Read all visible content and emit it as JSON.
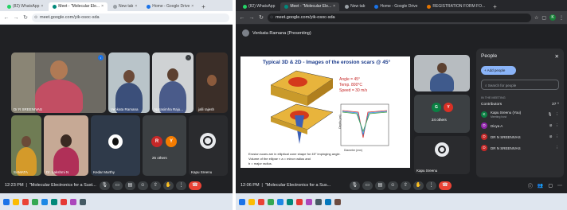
{
  "left": {
    "tabs": [
      {
        "label": "(82) WhatsApp",
        "active": false,
        "color": "#25d366"
      },
      {
        "label": "Meet - \"Molecular Ele...",
        "active": true,
        "color": "#00897b"
      },
      {
        "label": "New tab",
        "active": false,
        "color": "#9aa0a6"
      },
      {
        "label": "Home - Google Drive",
        "active": false,
        "color": "#1a73e8"
      }
    ],
    "url": "meet.google.com/yik-osoc-sda",
    "tiles": [
      {
        "name": "Dr R SREENIVAS"
      },
      {
        "name": "Venkata Ramana"
      },
      {
        "name": "Narasimha Raju..."
      },
      {
        "name": "jalli rajesh"
      },
      {
        "name": "SAMATA"
      },
      {
        "name": "Dr. Lakshmi N"
      },
      {
        "name": "Kedar Murthy"
      },
      {
        "name": "25 others",
        "avatars": [
          "R",
          "Y"
        ]
      },
      {
        "name": "Kapu Sreenu"
      }
    ],
    "bottom": {
      "time": "12:23 PM",
      "title": "\"Molecular Electronics for a Sust..."
    }
  },
  "right": {
    "tabs": [
      {
        "label": "(82) WhatsApp",
        "active": false,
        "color": "#25d366"
      },
      {
        "label": "Meet - \"Molecular Ele...",
        "active": true,
        "color": "#00897b"
      },
      {
        "label": "New tab",
        "active": false,
        "color": "#9aa0a6"
      },
      {
        "label": "Home - Google Drive",
        "active": false,
        "color": "#1a73e8"
      },
      {
        "label": "REGISTRATION FORM FO...",
        "active": false,
        "color": "#e37400"
      }
    ],
    "url": "meet.google.com/yik-osoc-sda",
    "presenter": "Venkata Ramana (Presenting)",
    "slide": {
      "title": "Typical 3D & 2D - Images of the erosion scars @ 45°",
      "params": [
        "Angle = 45°",
        "Temp. 800°C",
        "Speed = 30 m/s"
      ],
      "bullets": [
        "Erosion scars are in elliptical cone shape for 45° impinging angle.",
        "Volume of the ellipse ≈ a = minor radius and",
        "b = major radius."
      ],
      "xlabel": "Diameter (mm)",
      "ylabel": "Depth (μm)"
    },
    "side_tiles": [
      {
        "name": ""
      },
      {
        "name": "24 others",
        "avatars": [
          "G",
          "Y"
        ]
      },
      {
        "name": "Kapu Sreenu"
      }
    ],
    "panel": {
      "title": "People",
      "add_label": "Add people",
      "search_placeholder": "Search for people",
      "section": "IN THE MEETING",
      "group": "Contributors",
      "count": "37",
      "people": [
        {
          "name": "Kapu Sreenu (You)",
          "sub": "Meeting host",
          "initial": "K",
          "color": "#0b8043"
        },
        {
          "name": "Divya A",
          "sub": "",
          "initial": "D",
          "color": "#8e24aa"
        },
        {
          "name": "DR N SREENIVAS",
          "sub": "",
          "initial": "D",
          "color": "#c62828"
        },
        {
          "name": "DR N SREENIVAS",
          "sub": "",
          "initial": "D",
          "color": "#c62828"
        }
      ]
    },
    "bottom": {
      "time": "12:06 PM",
      "title": "\"Molecular Electronics for a Sus..."
    }
  }
}
